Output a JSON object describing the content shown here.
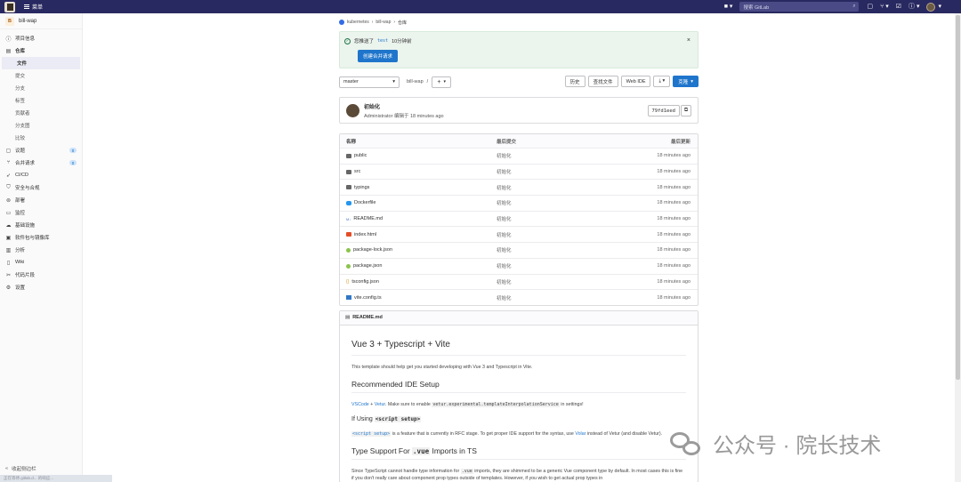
{
  "topbar": {
    "menu_label": "菜单",
    "search_placeholder": "搜索 GitLab",
    "search_shortcut": "/"
  },
  "sidebar": {
    "project_initial": "B",
    "project_name": "bill-wap",
    "items": [
      {
        "label": "项目信息",
        "icon": "info-icon"
      },
      {
        "label": "仓库",
        "icon": "repo-icon"
      }
    ],
    "repo_sub": [
      "文件",
      "提交",
      "分支",
      "标签",
      "贡献者",
      "分支图",
      "比较"
    ],
    "items2": [
      {
        "label": "议题",
        "icon": "issues-icon",
        "badge": "0"
      },
      {
        "label": "合并请求",
        "icon": "merge-request-icon",
        "badge": "0"
      },
      {
        "label": "CI/CD",
        "icon": "rocket-icon"
      },
      {
        "label": "安全与合规",
        "icon": "shield-icon"
      },
      {
        "label": "部署",
        "icon": "deploy-icon"
      },
      {
        "label": "监控",
        "icon": "monitor-icon"
      },
      {
        "label": "基础设施",
        "icon": "cloud-icon"
      },
      {
        "label": "软件包与镜像库",
        "icon": "package-icon"
      },
      {
        "label": "分析",
        "icon": "chart-icon"
      },
      {
        "label": "Wiki",
        "icon": "book-icon"
      },
      {
        "label": "代码片段",
        "icon": "scissors-icon"
      },
      {
        "label": "设置",
        "icon": "gear-icon"
      }
    ],
    "collapse_label": "收起侧边栏"
  },
  "breadcrumb": [
    "kubernetes",
    "bill-wap",
    "仓库"
  ],
  "alert": {
    "prefix": "您推送了",
    "branch": "test",
    "suffix": "10分钟前",
    "button": "创建合并请求"
  },
  "toolbar": {
    "branch": "master",
    "path": "bill-wap",
    "path_sep": "/",
    "history": "历史",
    "find_file": "查找文件",
    "web_ide": "Web IDE",
    "clone": "克隆"
  },
  "commit": {
    "title": "初始化",
    "author": "Administrator",
    "authored": "编辑于",
    "time": "18 minutes ago",
    "sha": "79fd1eed"
  },
  "files": {
    "headers": [
      "名称",
      "最后提交",
      "最后更新"
    ],
    "rows": [
      {
        "name": "public",
        "type": "folder",
        "commit": "初始化",
        "time": "18 minutes ago"
      },
      {
        "name": "src",
        "type": "folder",
        "commit": "初始化",
        "time": "18 minutes ago"
      },
      {
        "name": "typings",
        "type": "folder",
        "commit": "初始化",
        "time": "18 minutes ago"
      },
      {
        "name": "Dockerfile",
        "type": "docker",
        "commit": "初始化",
        "time": "18 minutes ago"
      },
      {
        "name": "README.md",
        "type": "md",
        "commit": "初始化",
        "time": "18 minutes ago"
      },
      {
        "name": "index.html",
        "type": "html",
        "commit": "初始化",
        "time": "18 minutes ago"
      },
      {
        "name": "package-lock.json",
        "type": "json",
        "commit": "初始化",
        "time": "18 minutes ago"
      },
      {
        "name": "package.json",
        "type": "json",
        "commit": "初始化",
        "time": "18 minutes ago"
      },
      {
        "name": "tsconfig.json",
        "type": "tsc",
        "commit": "初始化",
        "time": "18 minutes ago"
      },
      {
        "name": "vite.config.ts",
        "type": "ts",
        "commit": "初始化",
        "time": "18 minutes ago"
      }
    ]
  },
  "readme": {
    "file": "README.md",
    "h1": "Vue 3 + Typescript + Vite",
    "p1": "This template should help get you started developing with Vue 3 and Typescript in Vite.",
    "h2a": "Recommended IDE Setup",
    "ide_link1": "VSCode",
    "ide_plus": "+",
    "ide_link2": "Vetur",
    "ide_text": ". Make sure to enable",
    "ide_code": "vetur.experimental.templateInterpolationService",
    "ide_tail": "in settings!",
    "h3_prefix": "If Using",
    "h3_code": "<script setup>",
    "p3_code": "<script setup>",
    "p3_text": "is a feature that is currently in RFC stage. To get proper IDE support for the syntax, use",
    "p3_link": "Volar",
    "p3_tail": "instead of Vetur (and disable Vetur).",
    "h2b_prefix": "Type Support For",
    "h2b_code": ".vue",
    "h2b_suffix": "Imports in TS",
    "p4_a": "Since TypeScript cannot handle type information for",
    "p4_code": ".vue",
    "p4_b": "imports, they are shimmed to be a generic Vue component type by default. In most cases this is fine if you don't really care about component prop types outside of templates. However, if you wish to get actual prop types in"
  },
  "watermark": "公众号 · 院长技术",
  "statusbar": "正在等待 gitlab.d... 的响应..."
}
